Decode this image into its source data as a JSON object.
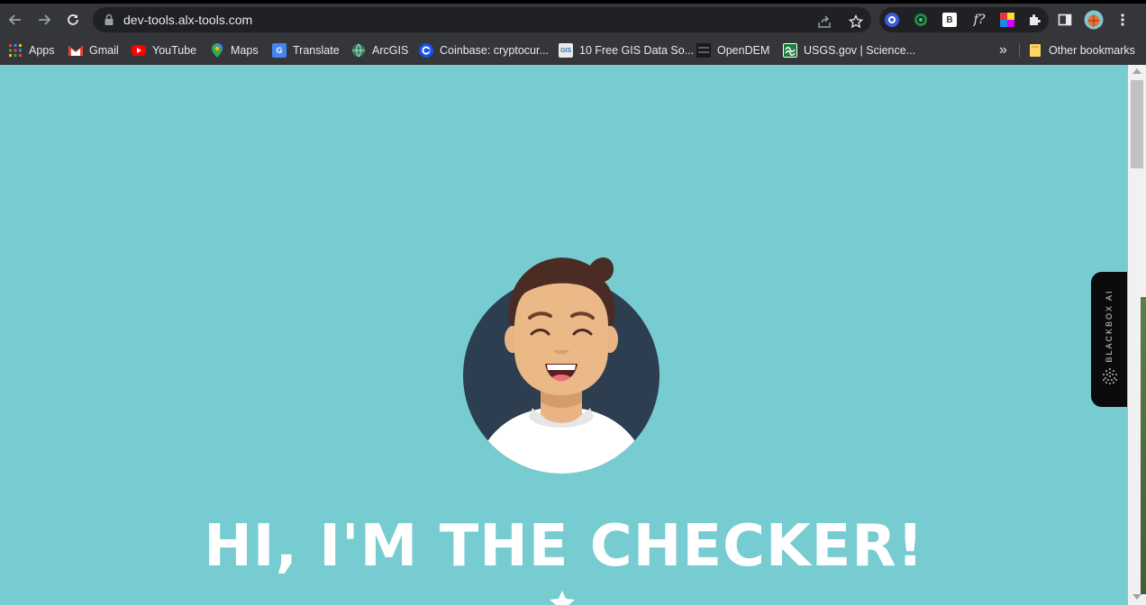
{
  "browser": {
    "url": "dev-tools.alx-tools.com",
    "bookmarks": [
      {
        "label": "Apps",
        "icon": "apps-grid-icon"
      },
      {
        "label": "Gmail",
        "icon": "gmail-icon"
      },
      {
        "label": "YouTube",
        "icon": "youtube-icon"
      },
      {
        "label": "Maps",
        "icon": "maps-pin-icon"
      },
      {
        "label": "Translate",
        "icon": "translate-icon"
      },
      {
        "label": "ArcGIS",
        "icon": "globe-icon"
      },
      {
        "label": "Coinbase: cryptocur...",
        "icon": "coinbase-icon"
      },
      {
        "label": "10 Free GIS Data So...",
        "icon": "gis-icon"
      },
      {
        "label": "OpenDEM",
        "icon": "opendem-icon"
      },
      {
        "label": "USGS.gov | Science...",
        "icon": "usgs-icon"
      }
    ],
    "bookmarks_overflow": "»",
    "other_bookmarks": "Other bookmarks",
    "extensions": {
      "b_label": "B",
      "f_label": "f?"
    }
  },
  "page": {
    "headline": "HI, I'M THE CHECKER!",
    "background_color": "#77ccd2",
    "blackbox_label": "BLACKBOX AI"
  }
}
